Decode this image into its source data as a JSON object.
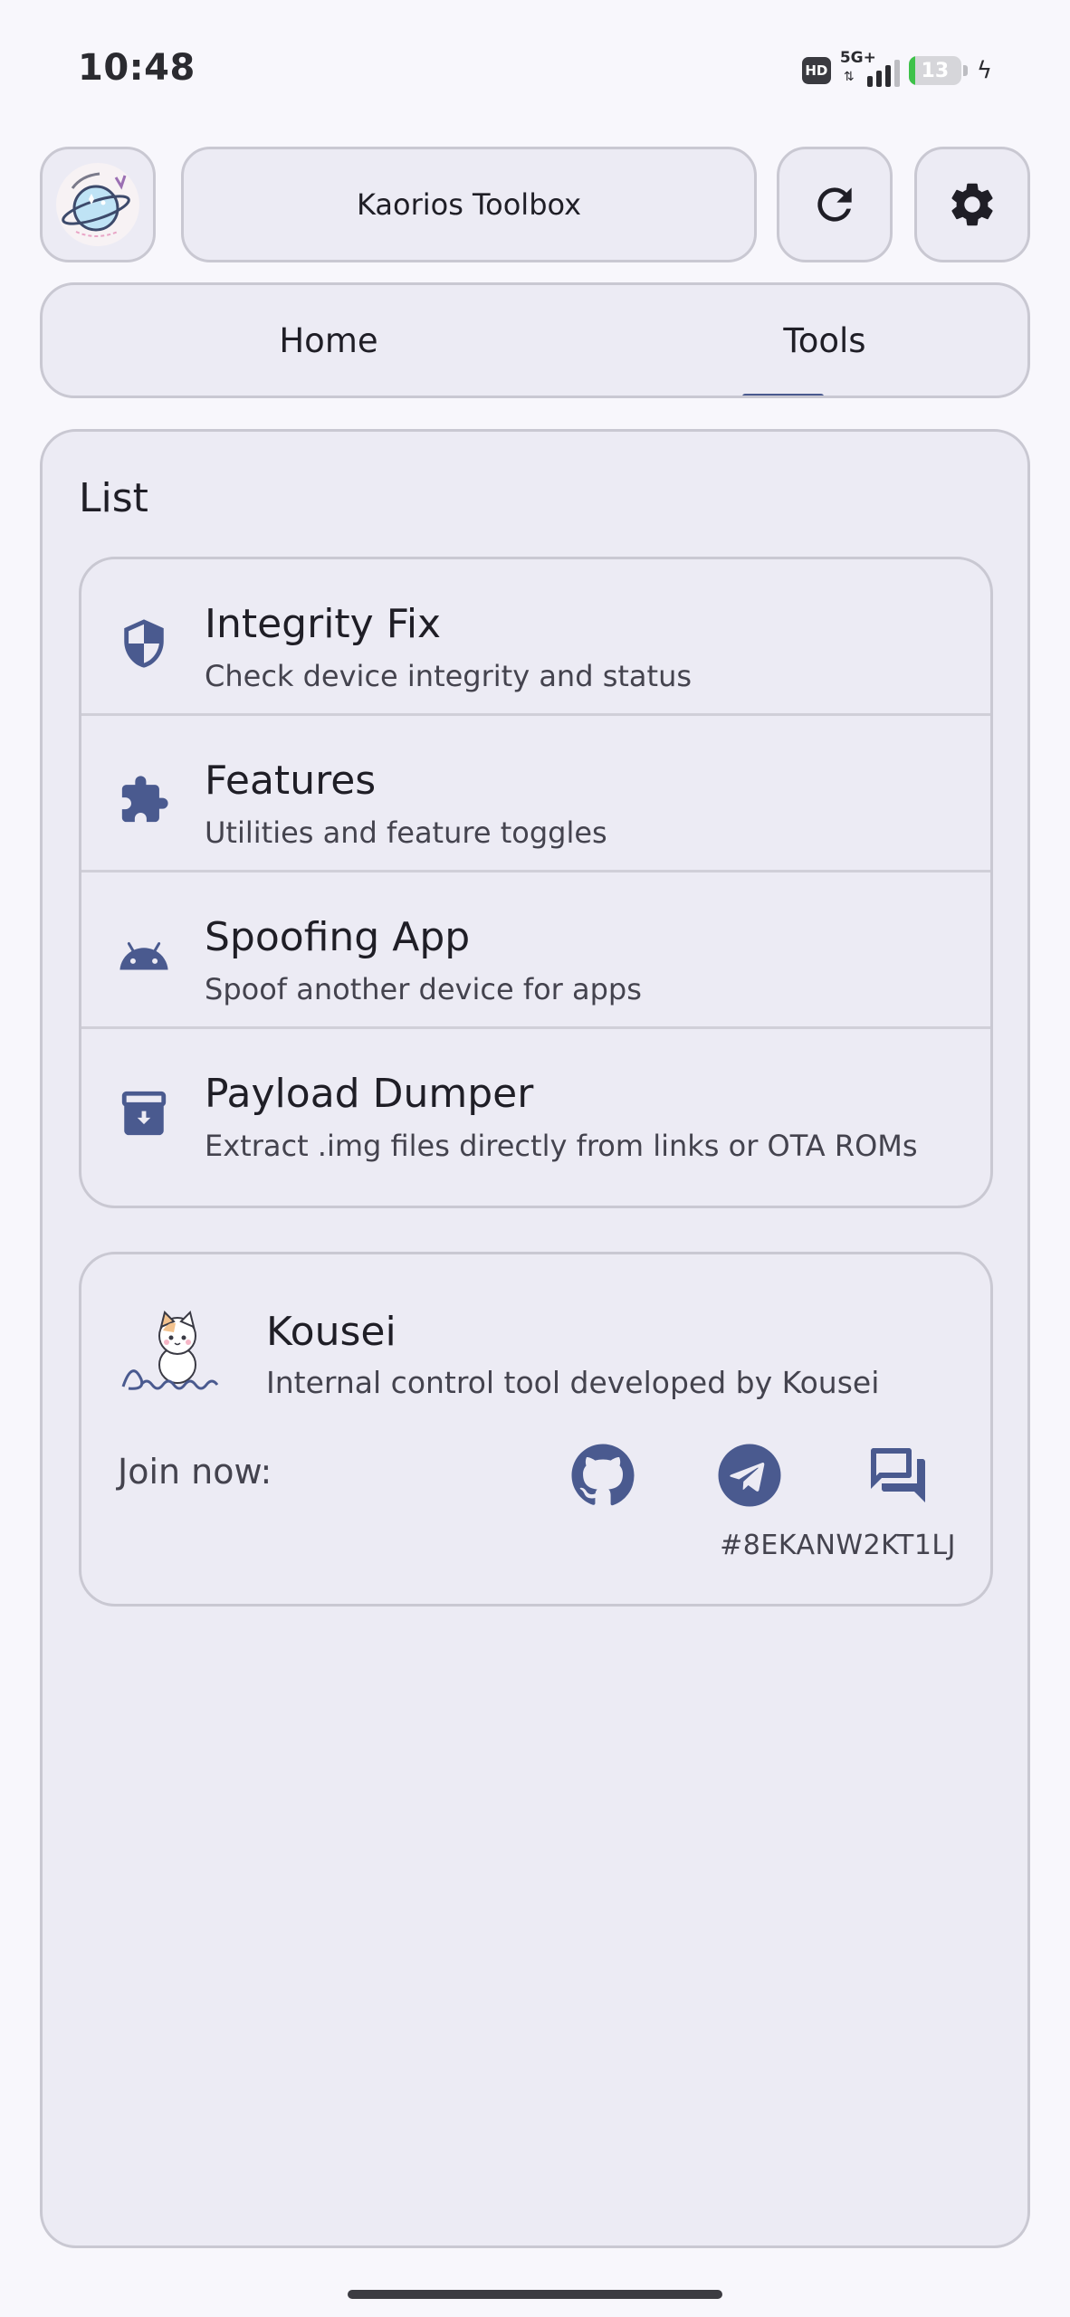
{
  "status_bar": {
    "time": "10:48",
    "hd": "HD",
    "network": "5G+",
    "battery_percent": "13",
    "battery_level": 0.13
  },
  "header": {
    "app_title": "Kaorios Toolbox",
    "logo_icon": "kaorios-planet-logo",
    "refresh_icon": "refresh-icon",
    "settings_icon": "gear-icon"
  },
  "tabs": {
    "items": [
      {
        "label": "Home",
        "active": false
      },
      {
        "label": "Tools",
        "active": true
      }
    ],
    "accent": "#4a5a8f"
  },
  "list": {
    "title": "List",
    "items": [
      {
        "title": "Integrity Fix",
        "description": "Check device integrity and status",
        "icon": "shield-icon"
      },
      {
        "title": "Features",
        "description": "Utilities and feature toggles",
        "icon": "puzzle-icon"
      },
      {
        "title": "Spoofing App",
        "description": "Spoof another device for apps",
        "icon": "android-icon"
      },
      {
        "title": "Payload Dumper",
        "description": "Extract .img files directly from links or OTA ROMs",
        "icon": "archive-icon"
      }
    ]
  },
  "author": {
    "name": "Kousei",
    "description": "Internal control tool developed by Kousei",
    "join_label": "Join now:",
    "invite_code": "#8EKANW2KT1LJ",
    "avatar_icon": "kousei-cat-avatar",
    "social": [
      {
        "icon": "github-icon"
      },
      {
        "icon": "telegram-icon"
      },
      {
        "icon": "chat-icon"
      }
    ]
  }
}
